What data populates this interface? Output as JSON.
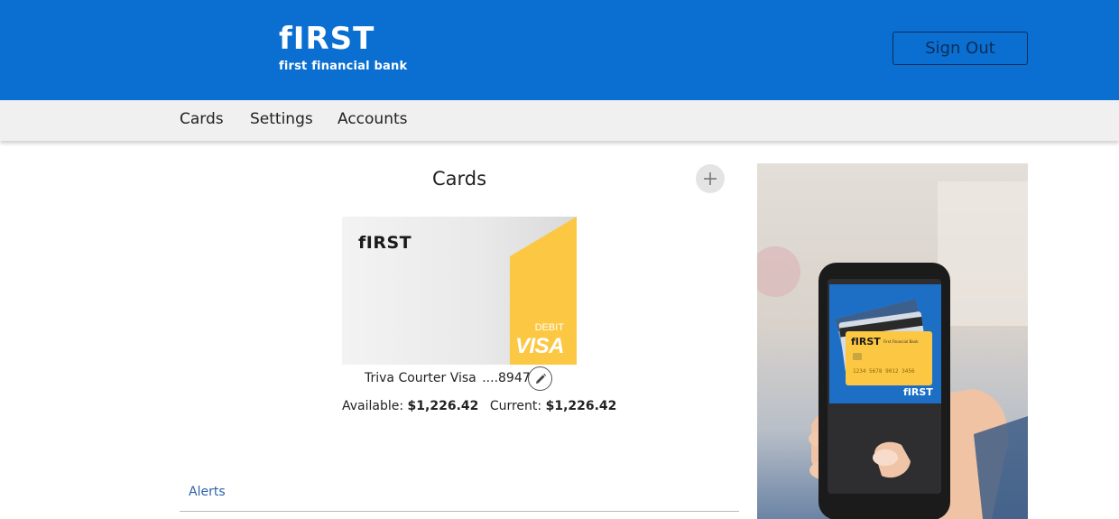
{
  "header": {
    "logo_word": "fIRST",
    "logo_tagline": "first financial bank",
    "signout_label": "Sign Out"
  },
  "nav": {
    "items": [
      {
        "label": "Cards"
      },
      {
        "label": "Settings"
      },
      {
        "label": "Accounts"
      }
    ]
  },
  "cards": {
    "title": "Cards",
    "add_icon": "plus-icon",
    "items": [
      {
        "brand_logo": "fIRST",
        "type_label": "DEBIT",
        "network": "VISA",
        "name": "Triva Courter Visa",
        "last4": "....8947",
        "available_label": "Available:",
        "available_value": "$1,226.42",
        "current_label": "Current:",
        "current_value": "$1,226.42",
        "edit_icon": "pencil-icon"
      }
    ]
  },
  "alerts": {
    "label": "Alerts"
  },
  "promo": {
    "card_logo": "fIRST",
    "card_tagline": "First Financial Bank",
    "card_number": "1234 5678 9012 3456",
    "phone_logo": "fIRST"
  },
  "colors": {
    "header_bg": "#0a6fd1",
    "nav_bg": "#f0f0f0",
    "card_accent": "#fcc742",
    "signout_border": "#0b2e5a",
    "link": "#2c63a8"
  }
}
